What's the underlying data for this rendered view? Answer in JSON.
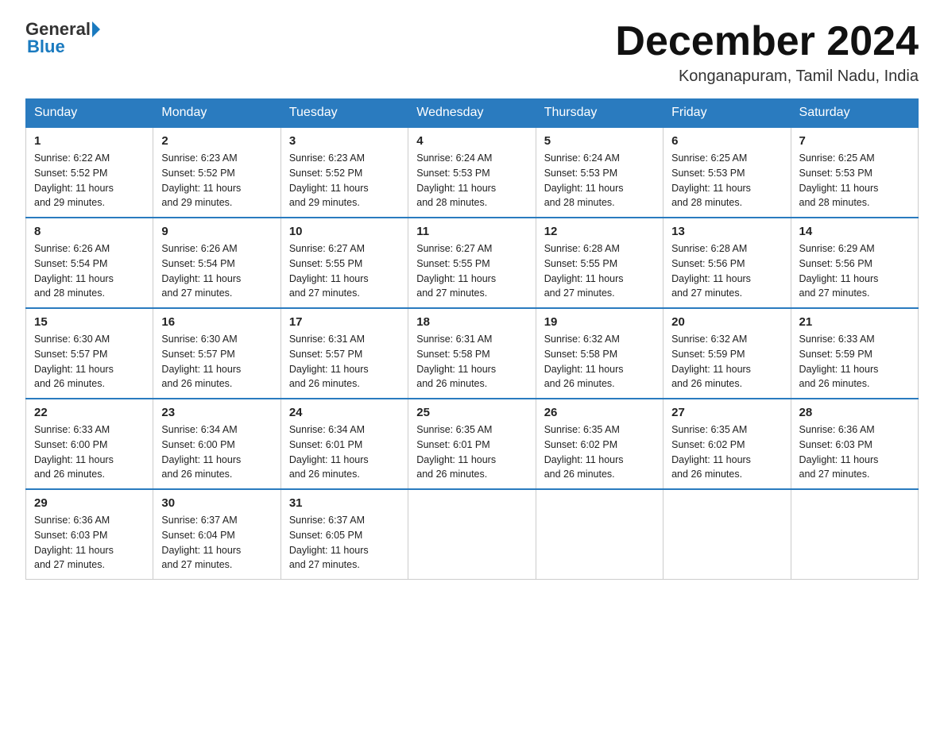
{
  "header": {
    "logo": {
      "general": "General",
      "blue": "Blue",
      "subtitle": "Blue"
    },
    "title": "December 2024",
    "location": "Konganapuram, Tamil Nadu, India"
  },
  "weekdays": [
    "Sunday",
    "Monday",
    "Tuesday",
    "Wednesday",
    "Thursday",
    "Friday",
    "Saturday"
  ],
  "weeks": [
    [
      {
        "day": "1",
        "sunrise": "6:22 AM",
        "sunset": "5:52 PM",
        "daylight": "11 hours and 29 minutes."
      },
      {
        "day": "2",
        "sunrise": "6:23 AM",
        "sunset": "5:52 PM",
        "daylight": "11 hours and 29 minutes."
      },
      {
        "day": "3",
        "sunrise": "6:23 AM",
        "sunset": "5:52 PM",
        "daylight": "11 hours and 29 minutes."
      },
      {
        "day": "4",
        "sunrise": "6:24 AM",
        "sunset": "5:53 PM",
        "daylight": "11 hours and 28 minutes."
      },
      {
        "day": "5",
        "sunrise": "6:24 AM",
        "sunset": "5:53 PM",
        "daylight": "11 hours and 28 minutes."
      },
      {
        "day": "6",
        "sunrise": "6:25 AM",
        "sunset": "5:53 PM",
        "daylight": "11 hours and 28 minutes."
      },
      {
        "day": "7",
        "sunrise": "6:25 AM",
        "sunset": "5:53 PM",
        "daylight": "11 hours and 28 minutes."
      }
    ],
    [
      {
        "day": "8",
        "sunrise": "6:26 AM",
        "sunset": "5:54 PM",
        "daylight": "11 hours and 28 minutes."
      },
      {
        "day": "9",
        "sunrise": "6:26 AM",
        "sunset": "5:54 PM",
        "daylight": "11 hours and 27 minutes."
      },
      {
        "day": "10",
        "sunrise": "6:27 AM",
        "sunset": "5:55 PM",
        "daylight": "11 hours and 27 minutes."
      },
      {
        "day": "11",
        "sunrise": "6:27 AM",
        "sunset": "5:55 PM",
        "daylight": "11 hours and 27 minutes."
      },
      {
        "day": "12",
        "sunrise": "6:28 AM",
        "sunset": "5:55 PM",
        "daylight": "11 hours and 27 minutes."
      },
      {
        "day": "13",
        "sunrise": "6:28 AM",
        "sunset": "5:56 PM",
        "daylight": "11 hours and 27 minutes."
      },
      {
        "day": "14",
        "sunrise": "6:29 AM",
        "sunset": "5:56 PM",
        "daylight": "11 hours and 27 minutes."
      }
    ],
    [
      {
        "day": "15",
        "sunrise": "6:30 AM",
        "sunset": "5:57 PM",
        "daylight": "11 hours and 26 minutes."
      },
      {
        "day": "16",
        "sunrise": "6:30 AM",
        "sunset": "5:57 PM",
        "daylight": "11 hours and 26 minutes."
      },
      {
        "day": "17",
        "sunrise": "6:31 AM",
        "sunset": "5:57 PM",
        "daylight": "11 hours and 26 minutes."
      },
      {
        "day": "18",
        "sunrise": "6:31 AM",
        "sunset": "5:58 PM",
        "daylight": "11 hours and 26 minutes."
      },
      {
        "day": "19",
        "sunrise": "6:32 AM",
        "sunset": "5:58 PM",
        "daylight": "11 hours and 26 minutes."
      },
      {
        "day": "20",
        "sunrise": "6:32 AM",
        "sunset": "5:59 PM",
        "daylight": "11 hours and 26 minutes."
      },
      {
        "day": "21",
        "sunrise": "6:33 AM",
        "sunset": "5:59 PM",
        "daylight": "11 hours and 26 minutes."
      }
    ],
    [
      {
        "day": "22",
        "sunrise": "6:33 AM",
        "sunset": "6:00 PM",
        "daylight": "11 hours and 26 minutes."
      },
      {
        "day": "23",
        "sunrise": "6:34 AM",
        "sunset": "6:00 PM",
        "daylight": "11 hours and 26 minutes."
      },
      {
        "day": "24",
        "sunrise": "6:34 AM",
        "sunset": "6:01 PM",
        "daylight": "11 hours and 26 minutes."
      },
      {
        "day": "25",
        "sunrise": "6:35 AM",
        "sunset": "6:01 PM",
        "daylight": "11 hours and 26 minutes."
      },
      {
        "day": "26",
        "sunrise": "6:35 AM",
        "sunset": "6:02 PM",
        "daylight": "11 hours and 26 minutes."
      },
      {
        "day": "27",
        "sunrise": "6:35 AM",
        "sunset": "6:02 PM",
        "daylight": "11 hours and 26 minutes."
      },
      {
        "day": "28",
        "sunrise": "6:36 AM",
        "sunset": "6:03 PM",
        "daylight": "11 hours and 27 minutes."
      }
    ],
    [
      {
        "day": "29",
        "sunrise": "6:36 AM",
        "sunset": "6:03 PM",
        "daylight": "11 hours and 27 minutes."
      },
      {
        "day": "30",
        "sunrise": "6:37 AM",
        "sunset": "6:04 PM",
        "daylight": "11 hours and 27 minutes."
      },
      {
        "day": "31",
        "sunrise": "6:37 AM",
        "sunset": "6:05 PM",
        "daylight": "11 hours and 27 minutes."
      },
      null,
      null,
      null,
      null
    ]
  ],
  "labels": {
    "sunrise": "Sunrise:",
    "sunset": "Sunset:",
    "daylight": "Daylight:"
  }
}
